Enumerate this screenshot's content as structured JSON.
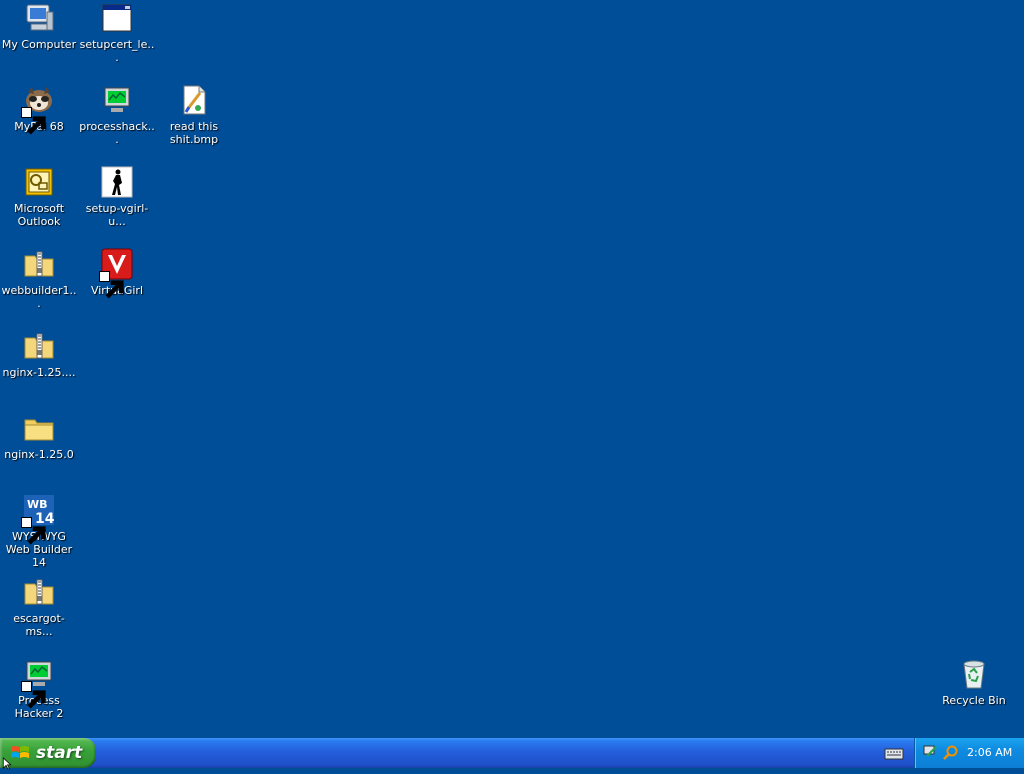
{
  "desktop": {
    "icons": [
      {
        "label": "My Computer",
        "icon": "my-computer-icon"
      },
      {
        "label": "setupcert_le...",
        "icon": "application-window-icon"
      },
      {
        "label": "MyPal 68",
        "icon": "mypal-raccoon-icon"
      },
      {
        "label": "processhack...",
        "icon": "process-hacker-icon"
      },
      {
        "label": "read this shit.bmp",
        "icon": "paint-bitmap-icon"
      },
      {
        "label": "Microsoft Outlook",
        "icon": "outlook-icon"
      },
      {
        "label": "setup-vgirl-u...",
        "icon": "vgirl-silhouette-icon"
      },
      {
        "label": "webbuilder1...",
        "icon": "zip-folder-icon"
      },
      {
        "label": "VirtuaGirl",
        "icon": "virtuagirl-icon"
      },
      {
        "label": "nginx-1.25....",
        "icon": "zip-folder-icon"
      },
      {
        "label": "nginx-1.25.0",
        "icon": "folder-icon"
      },
      {
        "label": "WYSIWYG Web Builder 14",
        "icon": "webbuilder-icon"
      },
      {
        "label": "escargot-ms...",
        "icon": "zip-folder-icon"
      },
      {
        "label": "Process Hacker 2",
        "icon": "process-hacker-icon"
      },
      {
        "label": "Recycle Bin",
        "icon": "recycle-bin-icon"
      }
    ]
  },
  "taskbar": {
    "start_label": "start",
    "clock": "2:06 AM"
  },
  "colors": {
    "desktop_bg": "#004e98",
    "taskbar_blue": "#245edb",
    "start_green": "#3aa33a",
    "tray_blue": "#0f8be0"
  }
}
